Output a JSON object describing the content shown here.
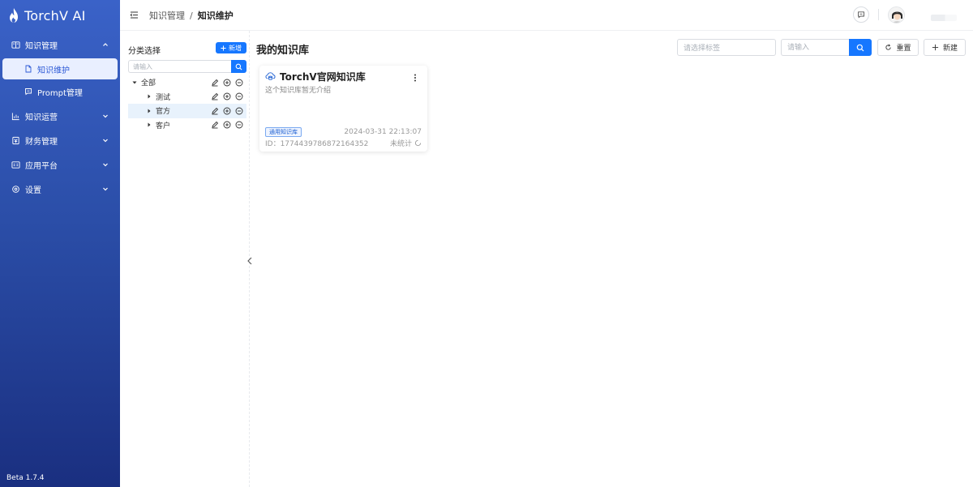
{
  "app": {
    "name": "TorchV AI",
    "version": "Beta 1.7.4",
    "brand_color": "#2d5ad6",
    "primary_color": "#1677ff"
  },
  "sidebar": {
    "groups": [
      {
        "label": "知识管理",
        "icon": "book-icon",
        "expanded": true,
        "items": [
          {
            "label": "知识维护",
            "icon": "file-icon",
            "active": true
          },
          {
            "label": "Prompt管理",
            "icon": "message-icon",
            "active": false
          }
        ]
      },
      {
        "label": "知识运营",
        "icon": "bar-chart-icon",
        "expanded": false
      },
      {
        "label": "财务管理",
        "icon": "finance-icon",
        "expanded": false
      },
      {
        "label": "应用平台",
        "icon": "app-icon",
        "expanded": false
      },
      {
        "label": "设置",
        "icon": "settings-icon",
        "expanded": false
      }
    ]
  },
  "header": {
    "breadcrumb": [
      "知识管理",
      "知识维护"
    ],
    "separator": "/"
  },
  "category": {
    "title": "分类选择",
    "add_label": "新增",
    "search_placeholder": "请输入",
    "tree": {
      "root": "全部",
      "children": [
        "测试",
        "官方",
        "客户"
      ],
      "highlighted": "官方"
    }
  },
  "main": {
    "title": "我的知识库",
    "tag_placeholder": "请选择标签",
    "search_placeholder": "请输入",
    "reset_label": "重置",
    "new_label": "新建"
  },
  "cards": [
    {
      "title": "TorchV官网知识库",
      "description": "这个知识库暂无介绍",
      "tag": "通用知识库",
      "date": "2024-03-31 22:13:07",
      "id": "ID：1774439786872164352",
      "status": "未统计"
    }
  ]
}
